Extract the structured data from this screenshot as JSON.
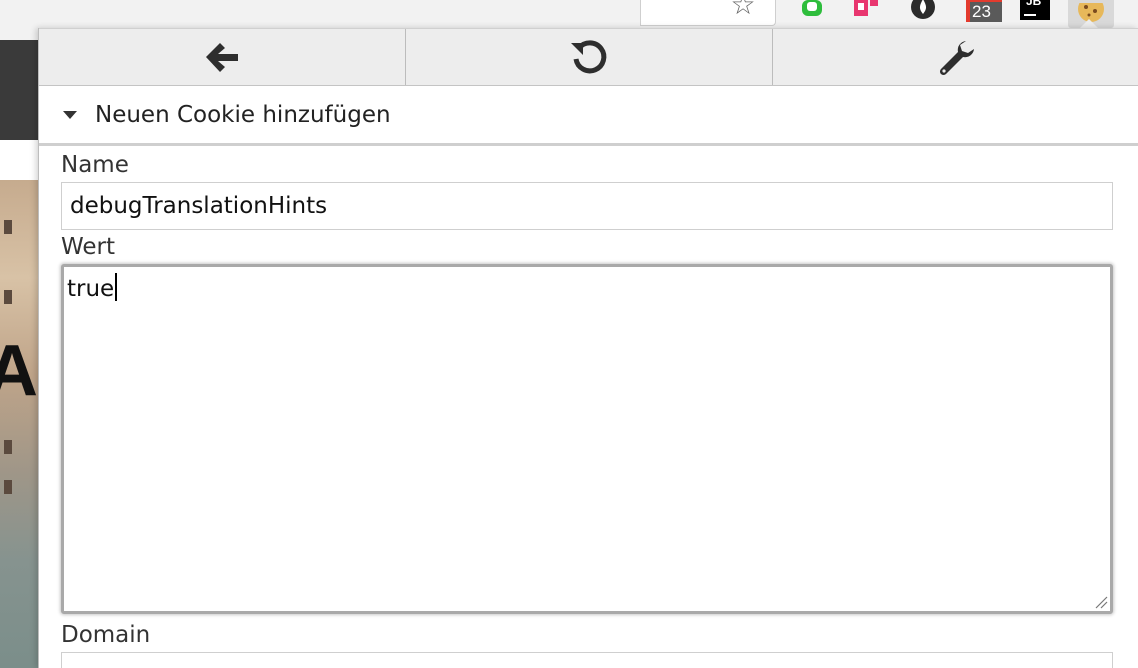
{
  "browser": {
    "extensions": {
      "calendar_badge": "23",
      "jetbrains_label": "JB"
    }
  },
  "popup": {
    "nav": {
      "back_icon": "arrow-left-icon",
      "refresh_icon": "refresh-icon",
      "settings_icon": "wrench-icon"
    },
    "section": {
      "title": "Neuen Cookie hinzufügen"
    },
    "form": {
      "name_label": "Name",
      "name_value": "debugTranslationHints",
      "value_label": "Wert",
      "value_text": "true",
      "domain_label": "Domain",
      "domain_value": ""
    }
  },
  "colors": {
    "nav_background": "#ededed",
    "border": "#cfcfcf",
    "text": "#222222"
  }
}
